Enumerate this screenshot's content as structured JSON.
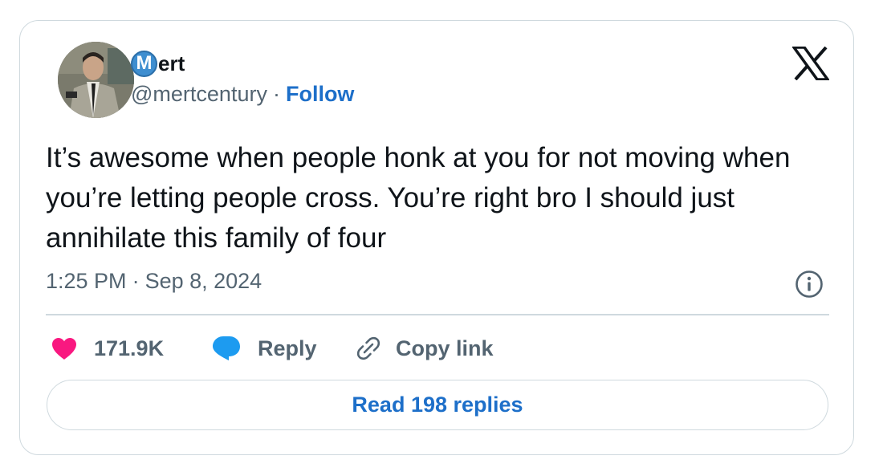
{
  "author": {
    "name_initial": "M",
    "name_rest": "ert",
    "handle": "@mertcentury",
    "separator": "·",
    "follow_label": "Follow"
  },
  "tweet": {
    "text": "It’s awesome when people honk at you for not moving when you’re letting people cross. You’re right bro I should just annihilate this family of four",
    "time": "1:25 PM",
    "separator": "·",
    "date": "Sep 8, 2024"
  },
  "actions": {
    "like_count": "171.9K",
    "reply_label": "Reply",
    "copy_link_label": "Copy link"
  },
  "read_replies_label": "Read 198 replies",
  "icons": {
    "like": "heart-icon",
    "reply": "speech-bubble-icon",
    "copy_link": "link-icon",
    "brand": "x-logo-icon",
    "info": "info-icon"
  },
  "colors": {
    "like": "#f91880",
    "reply": "#1d9bf0",
    "link": "#1d6fc9",
    "muted": "#536471",
    "text": "#0f1419",
    "border": "#cfd9de"
  }
}
